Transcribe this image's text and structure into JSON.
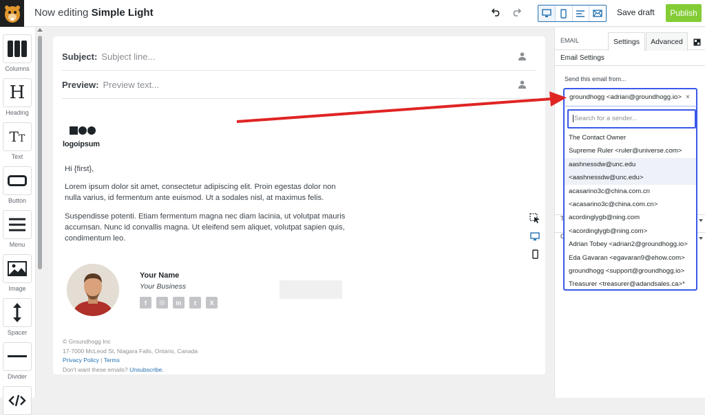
{
  "header": {
    "title_prefix": "Now editing",
    "title_name": "Simple Light",
    "save_draft": "Save draft",
    "publish": "Publish"
  },
  "blocks": [
    {
      "label": "Columns",
      "icon": "columns-icon"
    },
    {
      "label": "Heading",
      "icon": "heading-icon"
    },
    {
      "label": "Text",
      "icon": "text-icon"
    },
    {
      "label": "Button",
      "icon": "button-icon"
    },
    {
      "label": "Menu",
      "icon": "menu-icon"
    },
    {
      "label": "Image",
      "icon": "image-icon"
    },
    {
      "label": "Spacer",
      "icon": "spacer-icon"
    },
    {
      "label": "Divider",
      "icon": "divider-icon"
    }
  ],
  "email": {
    "subject_label": "Subject:",
    "subject_placeholder": "Subject line...",
    "preview_label": "Preview:",
    "preview_placeholder": "Preview text...",
    "logo_text": "logoipsum",
    "greeting": "Hi {first},",
    "para1": "Lorem ipsum dolor sit amet, consectetur adipiscing elit. Proin egestas dolor non nulla varius, id fermentum ante euismod. Ut a sodales nisl, at maximus felis.",
    "para2": "Suspendisse potenti. Etiam fermentum magna nec diam lacinia, ut volutpat mauris accumsan. Nunc id convallis magna. Ut eleifend sem aliquet, volutpat sapien quis, condimentum leo.",
    "sig_name": "Your Name",
    "sig_business": "Your Business",
    "social": [
      "f",
      "◎",
      "in",
      "t",
      "X"
    ],
    "footer_company": "© Groundhogg Inc",
    "footer_address": "17-7000 McLeod St, Niagara Falls, Ontario, Canada",
    "footer_privacy": "Privacy Policy",
    "footer_sep": " | ",
    "footer_terms": "Terms",
    "footer_unsub_prefix": "Don't want these emails? ",
    "footer_unsub": "Unsubscribe."
  },
  "panel": {
    "email_tab": "EMAIL",
    "settings_tab": "Settings",
    "advanced_tab": "Advanced",
    "heading": "Email Settings",
    "from_label": "Send this email from...",
    "selected": "groundhogg <adrian@groundhogg.io>",
    "clear": "×",
    "search_placeholder": "Search for a sender...",
    "row_t": "T",
    "row_c": "C",
    "options": [
      "The Contact Owner",
      "Supreme Ruler <ruler@universe.com>",
      "aashnessdw@unc.edu",
      "<aashnessdw@unc.edu>",
      "acasarino3c@china.com.cn",
      "<acasarino3c@china.com.cn>",
      "acordinglygb@ning.com",
      "<acordinglygb@ning.com>",
      "Adrian Tobey <adrian2@groundhogg.io>",
      "Eda Gavaran <egavaran9@ehow.com>",
      "groundhogg <support@groundhogg.io>",
      "Treasurer <treasurer@adandsales.ca>*"
    ],
    "highlighted": [
      2,
      3
    ]
  },
  "colors": {
    "accent": "#3858e9",
    "publish": "#84cc36",
    "link": "#2271b1",
    "annotation": "#e02424"
  }
}
